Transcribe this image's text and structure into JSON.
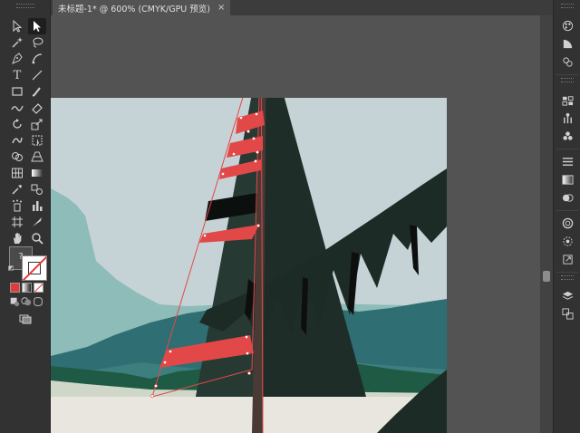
{
  "document_tab": {
    "title": "未标题-1* @ 600% (CMYK/GPU 预览)",
    "close_glyph": "×"
  },
  "toolbar": {
    "tools": [
      {
        "id": "selection-tool-icon",
        "glyph": "↖"
      },
      {
        "id": "direct-selection-tool-icon",
        "glyph": "↖",
        "selected": true
      },
      {
        "id": "magic-wand-tool-icon",
        "glyph": "✲"
      },
      {
        "id": "lasso-tool-icon",
        "glyph": "ᘓ"
      },
      {
        "id": "pen-tool-icon",
        "glyph": "✒"
      },
      {
        "id": "curvature-tool-icon",
        "glyph": "✎"
      },
      {
        "id": "type-tool-icon",
        "glyph": "T"
      },
      {
        "id": "line-segment-tool-icon",
        "glyph": "╱"
      },
      {
        "id": "rectangle-tool-icon",
        "glyph": "▭"
      },
      {
        "id": "paintbrush-tool-icon",
        "glyph": "⁄"
      },
      {
        "id": "shaper-tool-icon",
        "glyph": "∽"
      },
      {
        "id": "eraser-tool-icon",
        "glyph": "◇"
      },
      {
        "id": "rotate-tool-icon",
        "glyph": "↻"
      },
      {
        "id": "scale-tool-icon",
        "glyph": "⤡"
      },
      {
        "id": "warp-tool-icon",
        "glyph": "❦"
      },
      {
        "id": "free-transform-tool-icon",
        "glyph": "⬚"
      },
      {
        "id": "shape-builder-tool-icon",
        "glyph": "⊕"
      },
      {
        "id": "perspective-grid-tool-icon",
        "glyph": "▦"
      },
      {
        "id": "mesh-tool-icon",
        "glyph": "⊞"
      },
      {
        "id": "gradient-tool-icon",
        "glyph": "▬"
      },
      {
        "id": "eyedropper-tool-icon",
        "glyph": "✐"
      },
      {
        "id": "blend-tool-icon",
        "glyph": "◎"
      },
      {
        "id": "symbol-sprayer-tool-icon",
        "glyph": "❂"
      },
      {
        "id": "column-graph-tool-icon",
        "glyph": "▥"
      },
      {
        "id": "artboard-tool-icon",
        "glyph": "⌗"
      },
      {
        "id": "slice-tool-icon",
        "glyph": "⟋"
      },
      {
        "id": "hand-tool-icon",
        "glyph": "✋"
      },
      {
        "id": "zoom-tool-icon",
        "glyph": "⚲"
      }
    ],
    "fill_label": "?",
    "fill_color": "#4a4a4a",
    "stroke_color": "#e23b3b",
    "mode_icons": [
      "color-mode-icon",
      "gradient-mode-icon",
      "none-mode-icon"
    ],
    "draw_mode_icons": [
      "draw-normal-icon",
      "draw-behind-icon",
      "draw-inside-icon"
    ],
    "screen_mode_icon": "screen-mode-icon"
  },
  "right_dock": {
    "panels": [
      "color-guide-icon",
      "color-icon",
      "brushes-icon",
      "swatches-icon",
      "symbols-icon",
      "graphic-styles-icon",
      "stroke-icon",
      "gradient-icon",
      "transparency-icon",
      "appearance-icon",
      "cc-libraries-icon",
      "properties-icon",
      "export-icon",
      "layers-icon",
      "artboards-icon"
    ]
  },
  "colors": {
    "sky": "#c6d3d6",
    "far_mountain": "#8ebcb8",
    "mid_mountain": "#2f6f74",
    "dark_green": "#1f5a45",
    "tree": "#1f2d28",
    "trunk": "#4a3a36",
    "ground": "#e9e6e0",
    "selection_red": "#e34848",
    "ui_dark": "#323232",
    "ui_canvas": "#535353"
  }
}
